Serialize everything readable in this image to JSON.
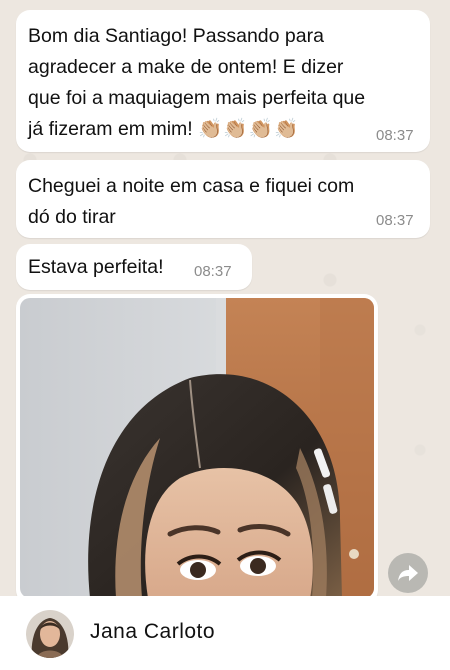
{
  "messages": [
    {
      "text": "Bom dia Santiago! Passando para\nagradecer a make de ontem! E dizer\nque foi a maquiagem mais perfeita que\njá fizeram em mim! ",
      "emoji": "👏🏼👏🏼👏🏼👏🏼",
      "time": "08:37"
    },
    {
      "text": "Cheguei a noite em casa e fiquei com\ndó do tirar",
      "time": "08:37"
    },
    {
      "text": "Estava perfeita!",
      "time": "08:37"
    }
  ],
  "media": {
    "description_icon": "photo-icon",
    "forward_icon": "forward-icon"
  },
  "contact": {
    "name": "Jana Carloto",
    "avatar_icon": "avatar-icon"
  },
  "colors": {
    "chat_background": "#EDE7E0",
    "bubble": "#FFFFFF",
    "timestamp": "#8C8C8C",
    "forward_button": "#B9B8B3"
  }
}
